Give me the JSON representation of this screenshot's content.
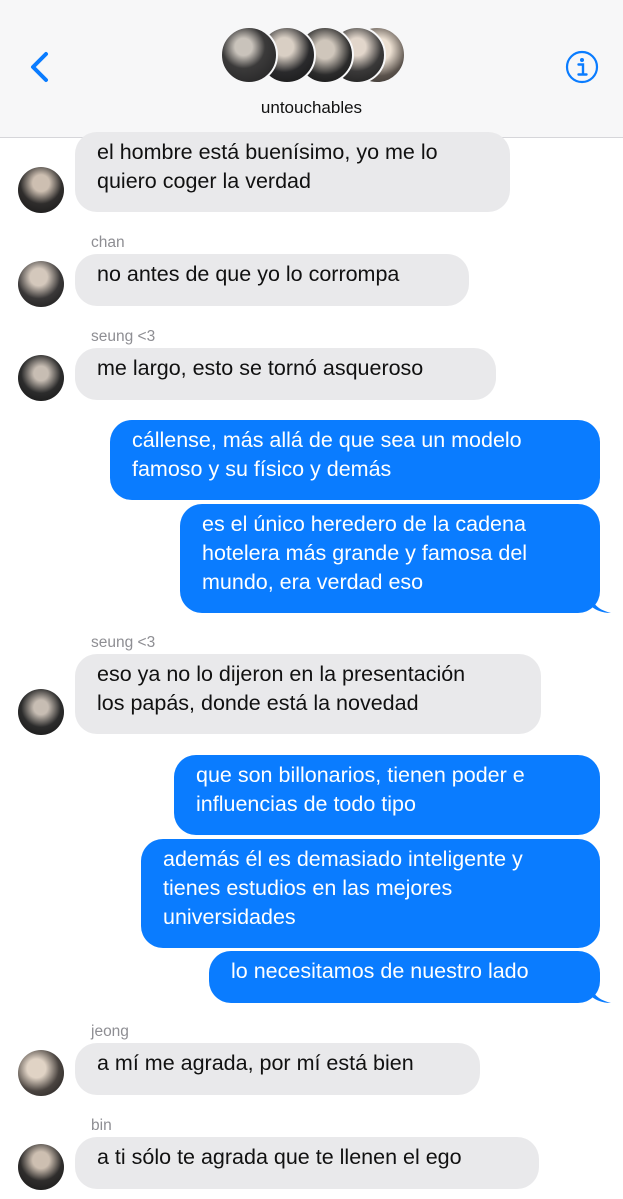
{
  "header": {
    "group_name": "untouchables",
    "back_icon": "chevron-left-icon",
    "info_icon": "info-icon",
    "accent": "#0a7cff"
  },
  "colors": {
    "incoming_bubble": "#e9e9eb",
    "outgoing_bubble": "#0a7cff"
  },
  "messages": [
    {
      "dir": "in",
      "sender": "",
      "text": [
        "el hombre está buenísimo, yo me lo",
        "quiero coger la verdad"
      ]
    },
    {
      "dir": "in",
      "sender": "chan",
      "text": [
        "no antes de que yo lo corrompa"
      ]
    },
    {
      "dir": "in",
      "sender": "seung <3",
      "text": [
        "me largo, esto se tornó asqueroso"
      ]
    },
    {
      "dir": "out",
      "sender": "",
      "text": [
        "cállense, más allá de que sea un modelo",
        "famoso y su físico y demás"
      ]
    },
    {
      "dir": "out",
      "sender": "",
      "text": [
        "es el único heredero de la cadena",
        "hotelera más grande y famosa del",
        "mundo, era verdad eso"
      ]
    },
    {
      "dir": "in",
      "sender": "seung <3",
      "text": [
        "eso ya no lo dijeron en la presentación",
        "los papás, donde está la novedad"
      ]
    },
    {
      "dir": "out",
      "sender": "",
      "text": [
        "que son billonarios, tienen poder e",
        "influencias de todo tipo"
      ]
    },
    {
      "dir": "out",
      "sender": "",
      "text": [
        "además él es demasiado inteligente y",
        "tienes estudios en las mejores",
        "universidades"
      ]
    },
    {
      "dir": "out",
      "sender": "",
      "text": [
        "lo necesitamos de nuestro lado"
      ]
    },
    {
      "dir": "in",
      "sender": "jeong",
      "text": [
        "a mí me agrada, por mí está bien"
      ]
    },
    {
      "dir": "in",
      "sender": "bin",
      "text": [
        "a ti sólo te agrada que te llenen el ego"
      ]
    }
  ]
}
